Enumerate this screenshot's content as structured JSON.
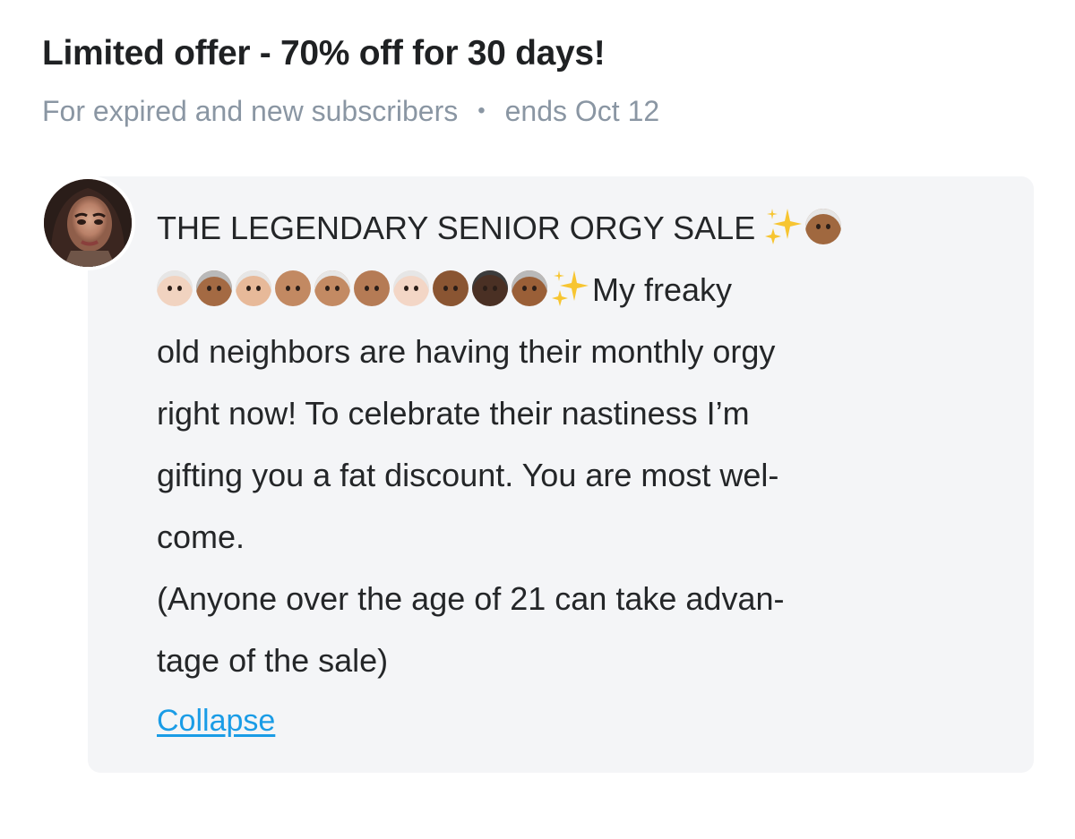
{
  "offer": {
    "title": "Limited offer - 70% off for 30 days!",
    "audience": "For expired and new subscribers",
    "separator": "•",
    "ends": "ends Oct 12"
  },
  "message": {
    "avatar_icon": "profile-photo",
    "line1_text": "THE LEGENDARY SENIOR ORGY SALE",
    "line2_text": "My freaky",
    "line3": "old neighbors are having their monthly orgy",
    "line4": "right now! To celebrate their nastiness I’m",
    "line5": "gifting you a fat discount. You are most wel-",
    "line6": "come.",
    "line7": "(Anyone over the age of 21 can take advan-",
    "line8": "tage of the sale)",
    "emoji_icons": [
      "sparkles-icon",
      "woman-white-hair-icon",
      "old-man-icon",
      "old-woman-icon",
      "old-woman-icon",
      "bald-man-icon",
      "woman-white-hair-icon",
      "old-man-icon",
      "old-woman-icon",
      "old-man-icon",
      "old-man-icon",
      "old-woman-icon",
      "sparkles-icon"
    ],
    "collapse_label": "Collapse"
  },
  "colors": {
    "title": "#1f2123",
    "meta": "#8a96a3",
    "card_background": "#f4f5f7",
    "link": "#1a9ce6",
    "body_text": "#242628"
  }
}
